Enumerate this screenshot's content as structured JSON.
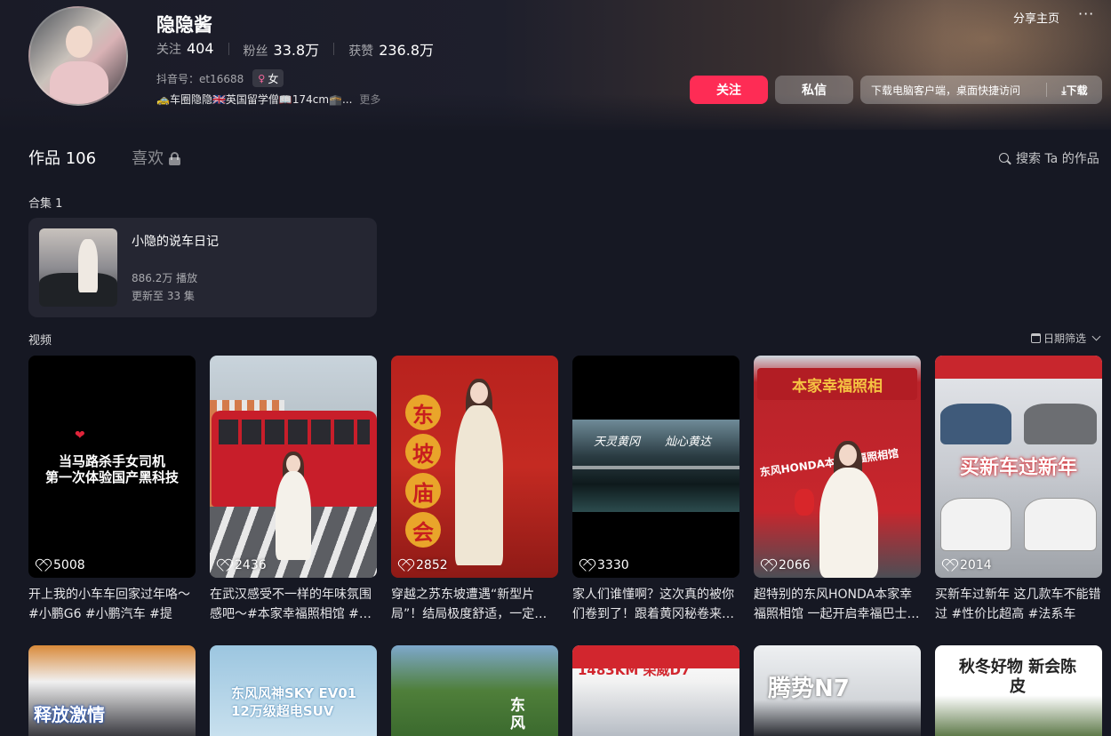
{
  "profile": {
    "nickname": "隐隐酱",
    "stats": [
      {
        "label": "关注",
        "value": "404"
      },
      {
        "label": "粉丝",
        "value": "33.8万"
      },
      {
        "label": "获赞",
        "value": "236.8万"
      }
    ],
    "douyin_id": "抖音号：et16688",
    "gender": "女",
    "bio": "🚕车圈隐隐🇬🇧英国留学僧📖174cm🕋...",
    "bio_more": "更多",
    "share_label": "分享主页",
    "more_label": "···",
    "follow_label": "关注",
    "message_label": "私信",
    "download_text": "下载电脑客户端，桌面快捷访问",
    "download_button": "⤓下载"
  },
  "tabs": [
    {
      "label": "作品 106",
      "active": true
    },
    {
      "label": "喜欢",
      "active": false
    }
  ],
  "search_label": "搜索 Ta 的作品",
  "collection": {
    "section_label": "合集 1",
    "title": "小隐的说车日记",
    "plays": "886.2万 播放",
    "update": "更新至 33 集"
  },
  "videos_section": {
    "label": "视频",
    "date_filter": "日期筛选"
  },
  "videos": [
    {
      "likes": "5008",
      "desc": "开上我的小车车回家过年咯～#小鹏G6 #小鹏汽车 #提车…",
      "overlay": [
        "当马路杀手女司机",
        "第一次体验国产黑科技"
      ]
    },
    {
      "likes": "2436",
      "desc": "在武汉感受不一样的年味氛围感吧～#本家幸福照相馆 #…"
    },
    {
      "likes": "2852",
      "desc": "穿越之苏东坡遭遇“新型片局”！结局极度舒适，一定…",
      "overlay_vertical": [
        "东",
        "坡",
        "庙",
        "会"
      ]
    },
    {
      "likes": "3330",
      "desc": "家人们谁懂啊？这次真的被你们卷到了！跟着黄冈秘卷来…",
      "overlay": [
        "天灵黄冈",
        "灿心黄达"
      ]
    },
    {
      "likes": "2066",
      "desc": "超特别的东风HONDA本家幸福照相馆 一起开启幸福巴士…",
      "overlay": [
        "本家幸福照相",
        "东风HONDA本家幸福照相馆"
      ]
    },
    {
      "likes": "2014",
      "desc": "买新车过新年 这几款车不能错过 #性价比超高 #法系车 #…",
      "overlay": [
        "买新车过新年"
      ]
    }
  ],
  "videos_row2": [
    {
      "overlay": "释放激情"
    },
    {
      "overlay": "东风风神SKY EV01 12万级超电SUV"
    },
    {
      "overlay": "东风"
    },
    {
      "overlay": "1483KM 荣威D7"
    },
    {
      "overlay": "腾势N7"
    },
    {
      "overlay": "秋冬好物 新会陈皮"
    }
  ],
  "colors": {
    "background": "#161823",
    "accent": "#fe2c55",
    "card": "#252632"
  }
}
